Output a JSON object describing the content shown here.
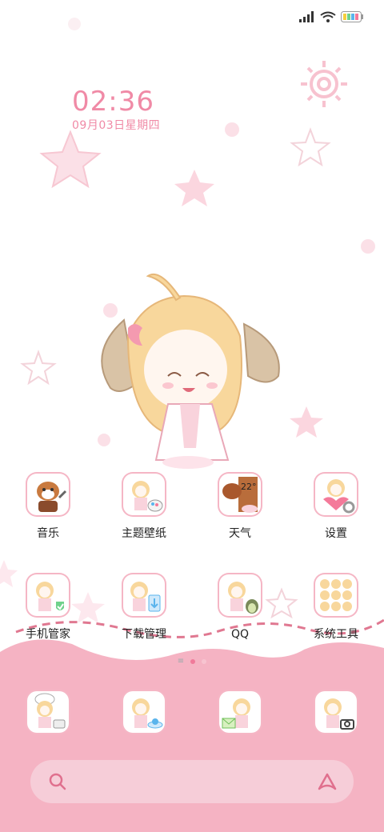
{
  "status_bar": {
    "signal_icon": "signal-bars-icon",
    "wifi_icon": "wifi-icon",
    "battery_icon": "battery-rainbow-icon"
  },
  "clock": {
    "time": "02:36",
    "date": "09月03日星期四"
  },
  "apps_row1": [
    {
      "label": "音乐",
      "icon": "music-dog-icon"
    },
    {
      "label": "主题壁纸",
      "icon": "theme-palette-icon"
    },
    {
      "label": "天气",
      "icon": "weather-icon",
      "temperature": "22°"
    },
    {
      "label": "设置",
      "icon": "settings-gear-icon"
    }
  ],
  "apps_row2": [
    {
      "label": "手机管家",
      "icon": "shield-check-icon"
    },
    {
      "label": "下载管理",
      "icon": "download-manager-icon"
    },
    {
      "label": "QQ",
      "icon": "qq-penguin-icon"
    },
    {
      "label": "系统工具",
      "icon": "system-tools-grid-icon"
    }
  ],
  "dock": [
    {
      "icon": "phone-chef-icon"
    },
    {
      "icon": "browser-ufo-icon"
    },
    {
      "icon": "messages-envelope-icon"
    },
    {
      "icon": "camera-icon"
    }
  ],
  "page_indicator": {
    "pages": 2,
    "active": 1
  },
  "search": {
    "search_icon": "search-icon",
    "assistant_icon": "assistant-a-icon"
  },
  "colors": {
    "accent": "#f08aa6",
    "dock_bg": "#f5b3c3",
    "search_bg": "#f6cdd8"
  }
}
